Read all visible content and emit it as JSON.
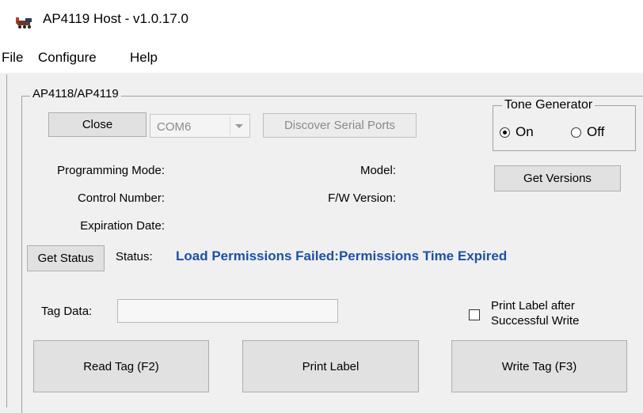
{
  "window": {
    "title": "AP4119 Host - v1.0.17.0"
  },
  "menu": {
    "items": [
      "File",
      "Configure",
      "Help"
    ]
  },
  "device_group": {
    "label": "AP4118/AP4119",
    "close_button": "Close",
    "port": "COM6",
    "discover_button": "Discover Serial Ports"
  },
  "tone_generator": {
    "label": "Tone Generator",
    "on_label": "On",
    "off_label": "Off",
    "selected": "On"
  },
  "info": {
    "programming_mode": "Programming Mode:",
    "control_number": "Control Number:",
    "expiration_date": "Expiration Date:",
    "model": "Model:",
    "fw_version": "F/W Version:",
    "get_versions_button": "Get Versions"
  },
  "status": {
    "get_status_button": "Get Status",
    "label": "Status:",
    "value": "Load Permissions Failed:Permissions Time Expired",
    "value_color": "#1f50a5"
  },
  "tag": {
    "label": "Tag Data:",
    "value": "",
    "print_after_write_line1": "Print Label after",
    "print_after_write_line2": "Successful Write",
    "print_after_write_checked": false
  },
  "actions": {
    "read_tag": "Read Tag (F2)",
    "print_label": "Print Label",
    "write_tag": "Write Tag (F3)"
  }
}
